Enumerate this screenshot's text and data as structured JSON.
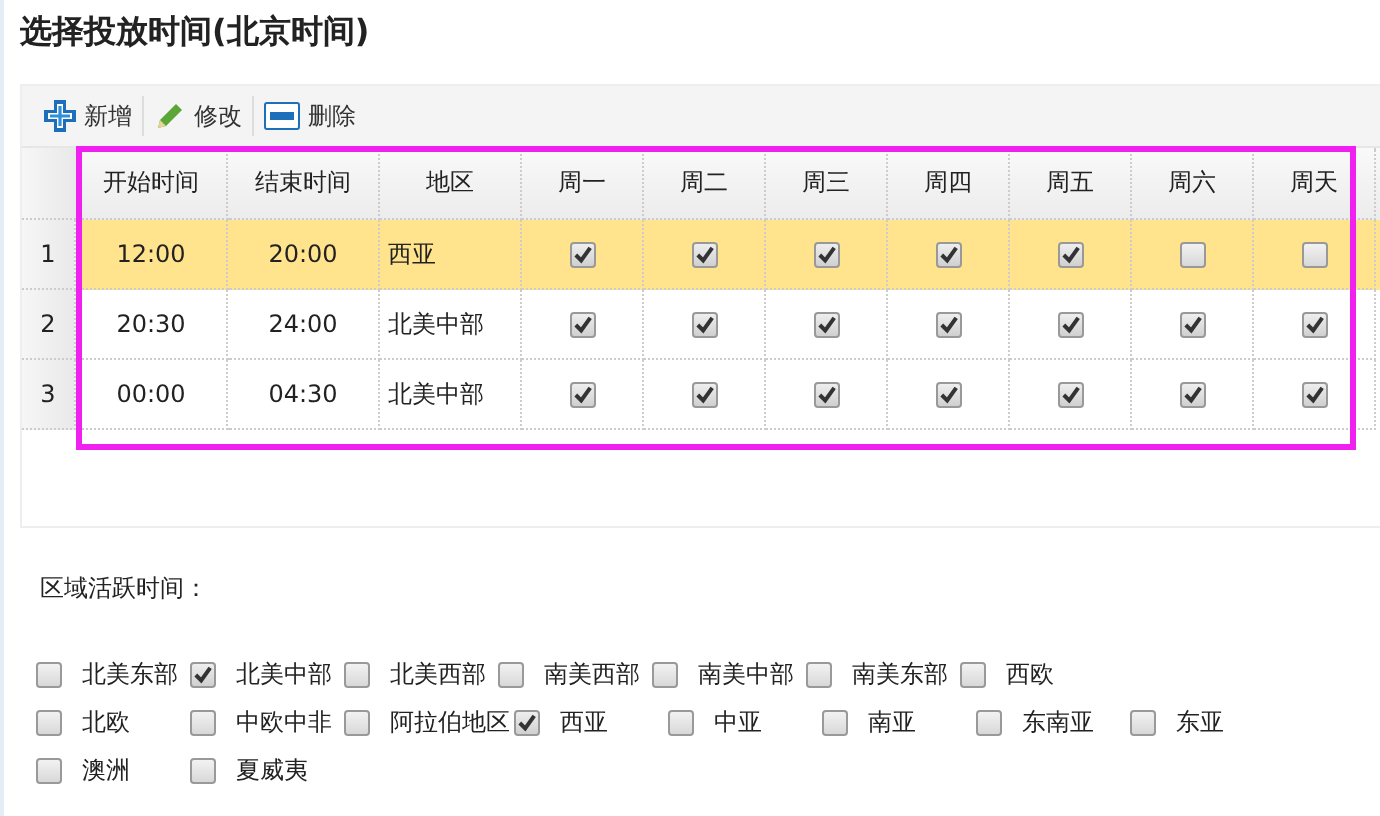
{
  "title": "选择投放时间(北京时间)",
  "toolbar": [
    {
      "kind": "add",
      "label": "新增"
    },
    {
      "kind": "edit",
      "label": "修改"
    },
    {
      "kind": "delete",
      "label": "删除"
    }
  ],
  "table": {
    "columns": [
      "开始时间",
      "结束时间",
      "地区",
      "周一",
      "周二",
      "周三",
      "周四",
      "周五",
      "周六",
      "周天"
    ],
    "rows": [
      {
        "number": "1",
        "selected": true,
        "start": "12:00",
        "end": "20:00",
        "region": "西亚",
        "days": [
          true,
          true,
          true,
          true,
          true,
          false,
          false
        ]
      },
      {
        "number": "2",
        "selected": false,
        "start": "20:30",
        "end": "24:00",
        "region": "北美中部",
        "days": [
          true,
          true,
          true,
          true,
          true,
          true,
          true
        ]
      },
      {
        "number": "3",
        "selected": false,
        "start": "00:00",
        "end": "04:30",
        "region": "北美中部",
        "days": [
          true,
          true,
          true,
          true,
          true,
          true,
          true
        ]
      }
    ]
  },
  "regions_label": "区域活跃时间：",
  "regions": [
    [
      {
        "label": "北美东部",
        "checked": false
      },
      {
        "label": "北美中部",
        "checked": true
      },
      {
        "label": "北美西部",
        "checked": false
      },
      {
        "label": "南美西部",
        "checked": false
      },
      {
        "label": "南美中部",
        "checked": false
      },
      {
        "label": "南美东部",
        "checked": false
      },
      {
        "label": "西欧",
        "checked": false
      }
    ],
    [
      {
        "label": "北欧",
        "checked": false
      },
      {
        "label": "中欧中非",
        "checked": false
      },
      {
        "label": "阿拉伯地区",
        "checked": false
      },
      {
        "label": "西亚",
        "checked": true
      },
      {
        "label": "中亚",
        "checked": false
      },
      {
        "label": "南亚",
        "checked": false
      },
      {
        "label": "东南亚",
        "checked": false
      },
      {
        "label": "东亚",
        "checked": false
      }
    ],
    [
      {
        "label": "澳洲",
        "checked": false
      },
      {
        "label": "夏威夷",
        "checked": false
      }
    ]
  ]
}
